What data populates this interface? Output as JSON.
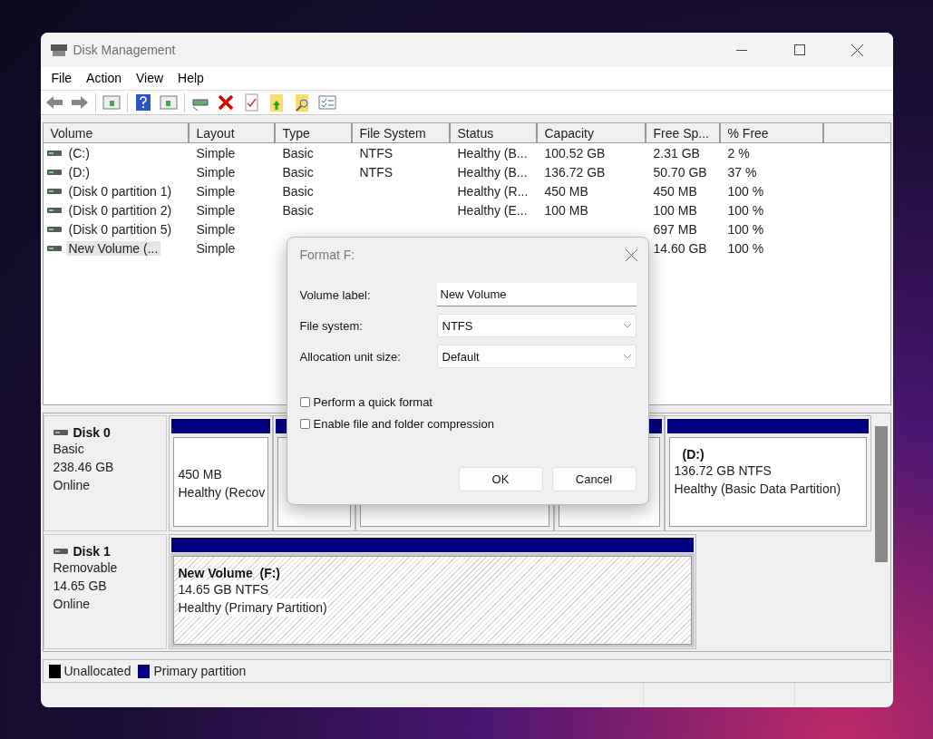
{
  "window": {
    "title": "Disk Management"
  },
  "menu": [
    "File",
    "Action",
    "View",
    "Help"
  ],
  "volume_table": {
    "columns": [
      "Volume",
      "Layout",
      "Type",
      "File System",
      "Status",
      "Capacity",
      "Free Sp...",
      "% Free"
    ],
    "rows": [
      {
        "selected": false,
        "cells": [
          "(C:)",
          "Simple",
          "Basic",
          "NTFS",
          "Healthy (B...",
          "100.52 GB",
          "2.31 GB",
          "2 %"
        ]
      },
      {
        "selected": false,
        "cells": [
          "(D:)",
          "Simple",
          "Basic",
          "NTFS",
          "Healthy (B...",
          "136.72 GB",
          "50.70 GB",
          "37 %"
        ]
      },
      {
        "selected": false,
        "cells": [
          "(Disk 0 partition 1)",
          "Simple",
          "Basic",
          null,
          "Healthy (R...",
          "450 MB",
          "450 MB",
          "100 %"
        ]
      },
      {
        "selected": false,
        "cells": [
          "(Disk 0 partition 2)",
          "Simple",
          "Basic",
          null,
          "Healthy (E...",
          "100 MB",
          "100 MB",
          "100 %"
        ]
      },
      {
        "selected": false,
        "cells": [
          "(Disk 0 partition 5)",
          "Simple",
          null,
          null,
          null,
          null,
          "697 MB",
          "100 %"
        ]
      },
      {
        "selected": true,
        "cells": [
          "New Volume (...",
          "Simple",
          null,
          null,
          null,
          null,
          "14.60 GB",
          "100 %"
        ]
      }
    ]
  },
  "disks": [
    {
      "name": "Disk 0",
      "lines": [
        "Basic",
        "238.46 GB",
        "Online"
      ],
      "partitions": [
        {
          "selected": false,
          "lines": [
            "450 MB",
            "Healthy (Recov"
          ]
        },
        {
          "selected": false
        },
        {
          "selected": false
        },
        {
          "selected": false
        },
        {
          "selected": false,
          "title": "(D:)",
          "lines": [
            "136.72 GB NTFS",
            "Healthy (Basic Data Partition)"
          ]
        }
      ]
    },
    {
      "name": "Disk 1",
      "lines": [
        "Removable",
        "14.65 GB",
        "Online"
      ],
      "partitions": [
        {
          "selected": true,
          "title": "New Volume  (F:)",
          "lines": [
            "14.65 GB NTFS",
            "Healthy (Primary Partition)"
          ]
        }
      ]
    }
  ],
  "legend": [
    {
      "label": "Unallocated",
      "color": "#000000"
    },
    {
      "label": "Primary partition",
      "color": "#000080"
    }
  ],
  "dialog": {
    "title": "Format F:",
    "fields": [
      {
        "kind": "text",
        "label": "Volume label:",
        "value": "New Volume"
      },
      {
        "kind": "select",
        "label": "File system:",
        "value": "NTFS"
      },
      {
        "kind": "select",
        "label": "Allocation unit size:",
        "value": "Default"
      }
    ],
    "options": [
      {
        "label": "Perform a quick format",
        "checked": false
      },
      {
        "label": "Enable file and folder compression",
        "checked": false
      }
    ],
    "buttons": [
      "OK",
      "Cancel"
    ]
  }
}
